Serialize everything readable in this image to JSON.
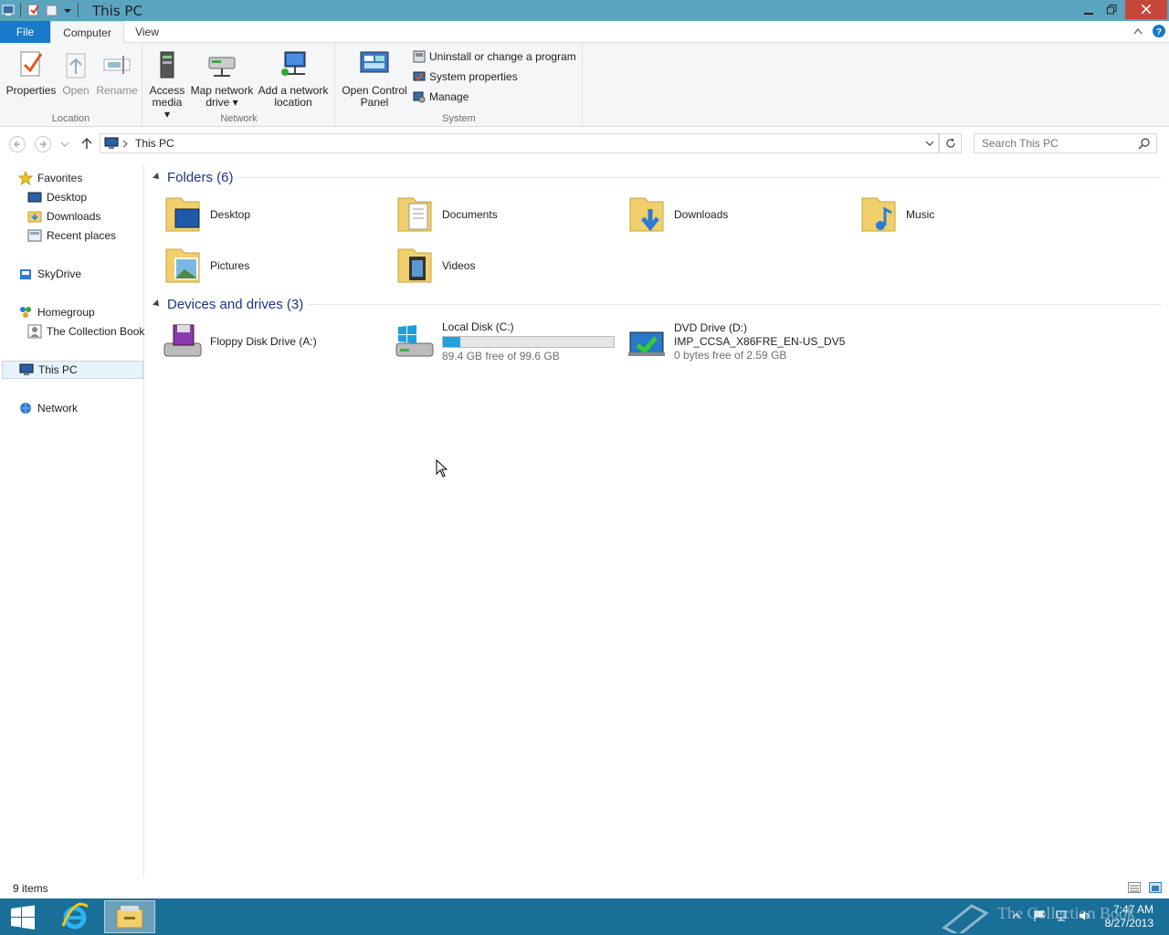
{
  "window": {
    "title": "This PC"
  },
  "ribbon": {
    "tabs": {
      "file": "File",
      "computer": "Computer",
      "view": "View"
    },
    "location": {
      "label": "Location",
      "properties": "Properties",
      "open": "Open",
      "rename": "Rename"
    },
    "network": {
      "label": "Network",
      "access_media_1": "Access",
      "access_media_2": "media ▾",
      "map_drive_1": "Map network",
      "map_drive_2": "drive ▾",
      "add_location_1": "Add a network",
      "add_location_2": "location"
    },
    "system": {
      "label": "System",
      "control_panel_1": "Open Control",
      "control_panel_2": "Panel",
      "uninstall": "Uninstall or change a program",
      "system_properties": "System properties",
      "manage": "Manage"
    }
  },
  "address": {
    "crumb": "This PC",
    "search_placeholder": "Search This PC"
  },
  "nav": {
    "favorites": "Favorites",
    "desktop": "Desktop",
    "downloads": "Downloads",
    "recent": "Recent places",
    "skydrive": "SkyDrive",
    "homegroup": "Homegroup",
    "collection_book": "The Collection Book",
    "this_pc": "This PC",
    "network": "Network"
  },
  "folders": {
    "heading": "Folders (6)",
    "items": [
      "Desktop",
      "Documents",
      "Downloads",
      "Music",
      "Pictures",
      "Videos"
    ]
  },
  "drives": {
    "heading": "Devices and drives (3)",
    "floppy": {
      "name": "Floppy Disk Drive (A:)"
    },
    "local": {
      "name": "Local Disk (C:)",
      "free": "89.4 GB free of 99.6 GB",
      "used_fraction": 0.102
    },
    "dvd": {
      "name": "DVD Drive (D:)",
      "label": "IMP_CCSA_X86FRE_EN-US_DV5",
      "free": "0 bytes free of 2.59 GB"
    }
  },
  "status": {
    "count": "9 items"
  },
  "taskbar": {
    "time": "7:47 AM",
    "date": "8/27/2013",
    "watermark": "The Collection Book"
  },
  "colors": {
    "titlebar": "#5aa4c0",
    "file_tab": "#1979ca",
    "taskbar": "#1a6f98",
    "drive_bar": "#26a0da",
    "heading_text": "#1e3287"
  }
}
